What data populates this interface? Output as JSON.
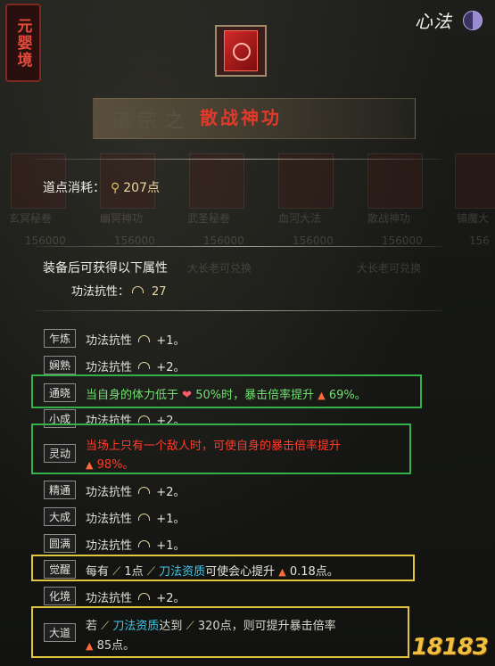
{
  "realm_label": "元婴境",
  "top_right": {
    "xinfa_label": "心法"
  },
  "background": {
    "title": "镇宗之",
    "item_labels": [
      "玄冥秘卷",
      "幽冥神功",
      "武圣秘卷",
      "血河大法",
      "散战神功",
      "镇魔大"
    ],
    "costs": [
      "156000",
      "156000",
      "156000",
      "156000",
      "156000",
      "156"
    ],
    "exchange_text": "大长老可兑换"
  },
  "skill_name": "散战神功",
  "cost": {
    "label": "道点消耗：",
    "value": "207点"
  },
  "equip": {
    "heading": "装备后可获得以下属性",
    "resist_label": "功法抗性：",
    "resist_value": "27"
  },
  "levels": [
    {
      "tag": "乍炼",
      "text": "功法抗性",
      "value": "+1。"
    },
    {
      "tag": "娴熟",
      "text": "功法抗性",
      "value": "+2。"
    },
    {
      "tag": "通晓",
      "text_a": "当自身的体力低于",
      "pct": "50%时，暴击倍率提升",
      "bonus": "69%。"
    },
    {
      "tag": "小成",
      "text": "功法抗性",
      "value": "+2。"
    },
    {
      "tag": "灵动",
      "line1": "当场上只有一个敌人时，可使自身的暴击倍率提升",
      "line2": "98%。"
    },
    {
      "tag": "精通",
      "text": "功法抗性",
      "value": "+2。"
    },
    {
      "tag": "大成",
      "text": "功法抗性",
      "value": "+1。"
    },
    {
      "tag": "圆满",
      "text": "功法抗性",
      "value": "+1。"
    },
    {
      "tag": "觉醒",
      "a": "每有",
      "b": "1点",
      "c": "刀法资质",
      "d": "可使会心提升",
      "e": "0.18点。"
    },
    {
      "tag": "化境",
      "text": "功法抗性",
      "value": "+2。"
    },
    {
      "tag": "大道",
      "a": "若",
      "b": "刀法资质",
      "c": "达到",
      "d": "320点，则可提升暴击倍率",
      "e": "85点。"
    }
  ],
  "watermark": "18183",
  "colors": {
    "accent_red": "#e23a2a",
    "green_box": "#34b249",
    "yellow_box": "#e2c640",
    "cyan": "#3fc8e8"
  }
}
